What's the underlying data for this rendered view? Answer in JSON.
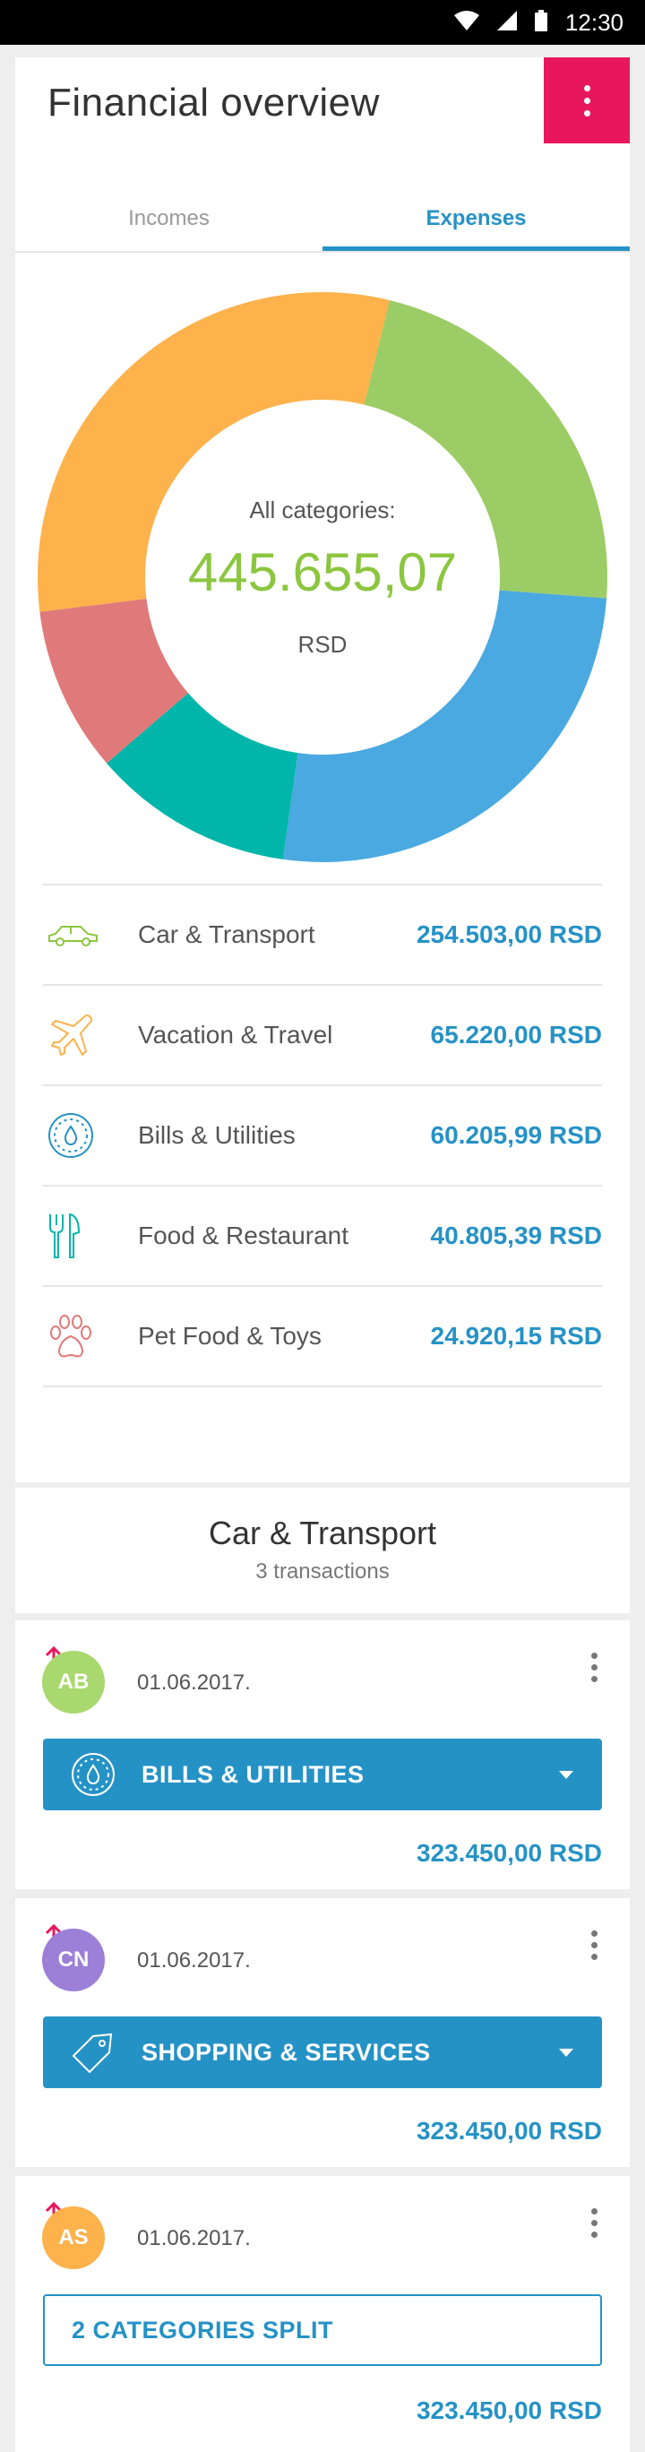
{
  "status": {
    "time": "12:30"
  },
  "header": {
    "title": "Financial overview"
  },
  "tabs": [
    {
      "label": "Incomes",
      "active": false
    },
    {
      "label": "Expenses",
      "active": true
    }
  ],
  "summary": {
    "label": "All categories:",
    "total": "445.655,07",
    "currency": "RSD"
  },
  "chart_data": {
    "type": "pie",
    "categories": [
      "Vacation & Travel",
      "Car & Transport",
      "Bills & Utilities",
      "Food & Restaurant",
      "Pet Food & Toys"
    ],
    "values": [
      29.5,
      21.5,
      25.0,
      11.0,
      9.0
    ],
    "colors": [
      "#fdb24b",
      "#9ccc65",
      "#4aa9e0",
      "#00b5a9",
      "#e07a7a"
    ]
  },
  "categories": [
    {
      "name": "Car & Transport",
      "amount": "254.503,00 RSD",
      "icon": "car-icon",
      "color": "#8cc63f"
    },
    {
      "name": "Vacation & Travel",
      "amount": "65.220,00 RSD",
      "icon": "airplane-icon",
      "color": "#fdb24b"
    },
    {
      "name": "Bills & Utilities",
      "amount": "60.205,99 RSD",
      "icon": "water-meter-icon",
      "color": "#2592c6"
    },
    {
      "name": "Food & Restaurant",
      "amount": "40.805,39 RSD",
      "icon": "fork-knife-icon",
      "color": "#00b5a9"
    },
    {
      "name": "Pet Food & Toys",
      "amount": "24.920,15 RSD",
      "icon": "paw-icon",
      "color": "#e07a7a"
    }
  ],
  "section": {
    "title": "Car & Transport",
    "subtitle": "3 transactions"
  },
  "transactions": [
    {
      "initials": "AB",
      "avatar_color": "#a9d86e",
      "date": "01.06.2017.",
      "category": "BILLS & UTILITIES",
      "category_icon": "water-meter-icon",
      "amount": "323.450,00 RSD"
    },
    {
      "initials": "CN",
      "avatar_color": "#9c7fd6",
      "date": "01.06.2017.",
      "category": "SHOPPING & SERVICES",
      "category_icon": "tag-icon",
      "amount": "323.450,00 RSD"
    },
    {
      "initials": "AS",
      "avatar_color": "#fdb24b",
      "date": "01.06.2017.",
      "category": "2 CATEGORIES SPLIT",
      "category_icon": "",
      "amount": "323.450,00 RSD"
    }
  ],
  "accent": "#2592c6",
  "menu_color": "#e8175d"
}
